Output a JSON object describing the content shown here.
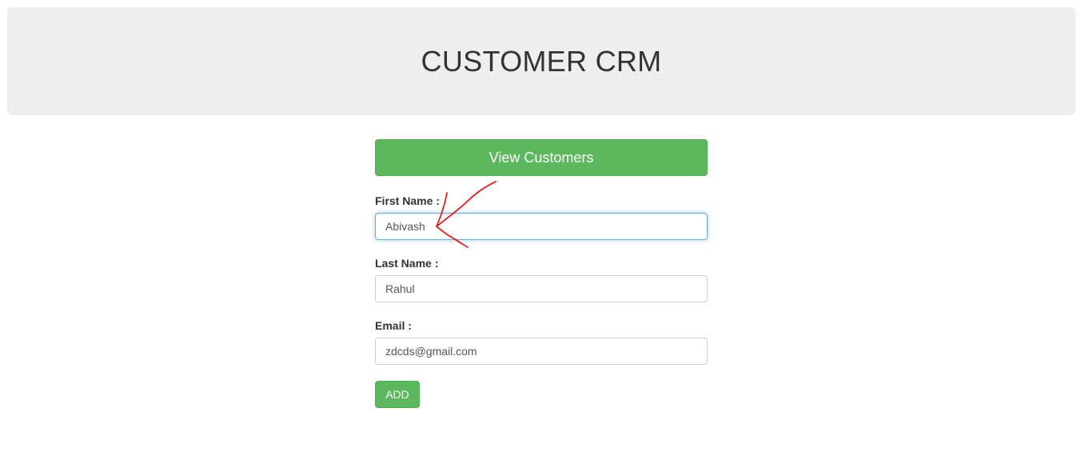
{
  "header": {
    "title": "CUSTOMER CRM"
  },
  "actions": {
    "view_customers_label": "View Customers",
    "add_label": "ADD"
  },
  "form": {
    "first_name": {
      "label": "First Name :",
      "value": "Abivash"
    },
    "last_name": {
      "label": "Last Name :",
      "value": "Rahul"
    },
    "email": {
      "label": "Email :",
      "value": "zdcds@gmail.com"
    }
  },
  "colors": {
    "header_bg": "#eeeeee",
    "button_green": "#5cb85c",
    "focus_border": "#66afe9",
    "annotation_red": "#ff0000"
  },
  "annotation": {
    "icon": "red-arrow-icon"
  }
}
